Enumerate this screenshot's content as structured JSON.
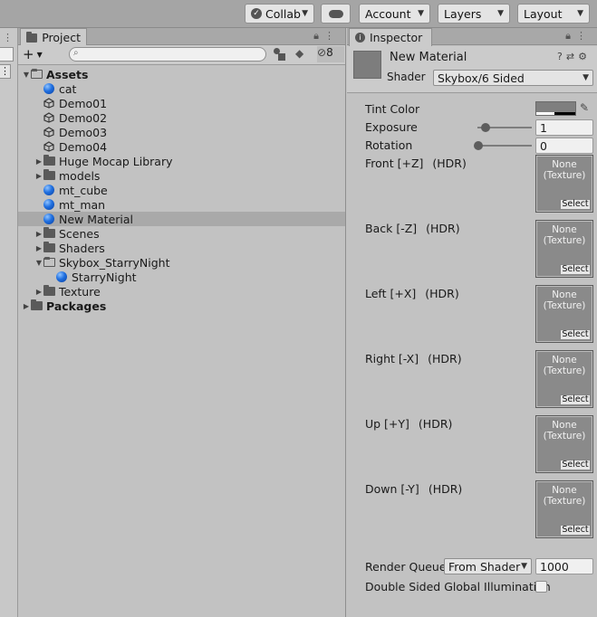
{
  "toolbar": {
    "collab": "Collab",
    "account": "Account",
    "layers": "Layers",
    "layout": "Layout"
  },
  "project": {
    "tab_label": "Project",
    "hidden_count": "8",
    "tree": [
      {
        "label": "Assets",
        "kind": "folder-open",
        "depth": 0,
        "bold": true
      },
      {
        "label": "cat",
        "kind": "material",
        "depth": 1
      },
      {
        "label": "Demo01",
        "kind": "scene",
        "depth": 1
      },
      {
        "label": "Demo02",
        "kind": "scene",
        "depth": 1
      },
      {
        "label": "Demo03",
        "kind": "scene",
        "depth": 1
      },
      {
        "label": "Demo04",
        "kind": "scene",
        "depth": 1
      },
      {
        "label": "Huge Mocap Library",
        "kind": "folder",
        "depth": 1
      },
      {
        "label": "models",
        "kind": "folder",
        "depth": 1
      },
      {
        "label": "mt_cube",
        "kind": "material",
        "depth": 1
      },
      {
        "label": "mt_man",
        "kind": "material",
        "depth": 1
      },
      {
        "label": "New Material",
        "kind": "material",
        "depth": 1,
        "selected": true
      },
      {
        "label": "Scenes",
        "kind": "folder",
        "depth": 1
      },
      {
        "label": "Shaders",
        "kind": "folder",
        "depth": 1
      },
      {
        "label": "Skybox_StarryNight",
        "kind": "folder-open",
        "depth": 1
      },
      {
        "label": "StarryNight",
        "kind": "material",
        "depth": 2
      },
      {
        "label": "Texture",
        "kind": "folder",
        "depth": 1
      },
      {
        "label": "Packages",
        "kind": "folder",
        "depth": 0,
        "bold": true
      }
    ]
  },
  "inspector": {
    "tab_label": "Inspector",
    "material_name": "New Material",
    "shader_label": "Shader",
    "shader_value": "Skybox/6 Sided",
    "tint_label": "Tint Color",
    "exposure_label": "Exposure",
    "exposure_value": "1",
    "exposure_level": 0.1,
    "rotation_label": "Rotation",
    "rotation_value": "0",
    "rotation_level": 0.0,
    "hdr": "(HDR)",
    "tex_none": "None",
    "tex_type": "(Texture)",
    "select": "Select",
    "faces": [
      {
        "label": "Front [+Z]"
      },
      {
        "label": "Back [-Z]"
      },
      {
        "label": "Left [+X]"
      },
      {
        "label": "Right [-X]"
      },
      {
        "label": "Up [+Y]"
      },
      {
        "label": "Down [-Y]"
      }
    ],
    "render_queue_label": "Render Queue",
    "render_queue_mode": "From Shader",
    "render_queue_value": "1000",
    "double_sided_label": "Double Sided Global Illumination"
  }
}
